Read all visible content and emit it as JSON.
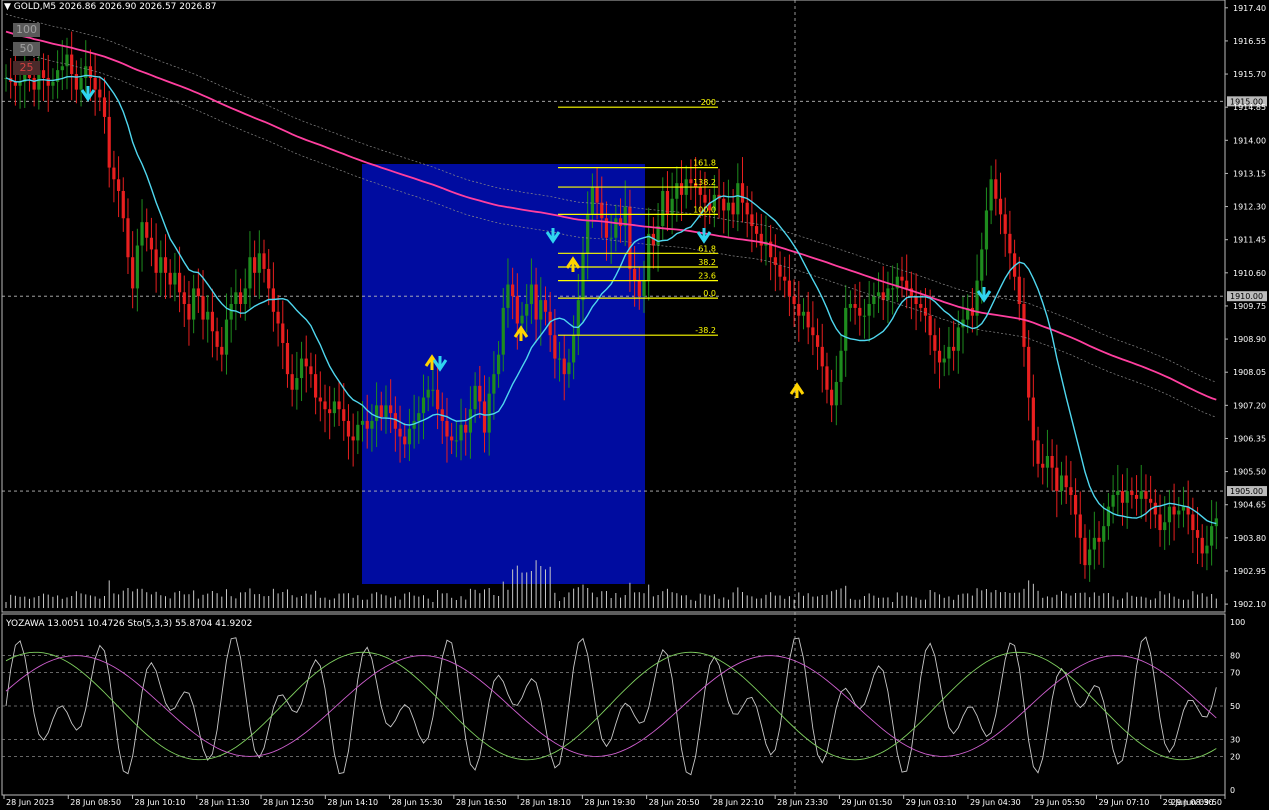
{
  "header": {
    "symbol_label": "GOLD,M5",
    "ohlc": "2026.86 2026.90 2026.57 2026.87",
    "indicator_label": "YOZAWA 13.0051 10.4726",
    "stoch_label": "Sto(5,3,3) 55.8704 41.9202"
  },
  "buttons": [
    {
      "label": "100",
      "color": "#a0a0a0"
    },
    {
      "label": "50",
      "color": "#a0a0a0"
    },
    {
      "label": "25",
      "color": "#d04040"
    }
  ],
  "colors": {
    "bull": "#1e8c1e",
    "bear": "#e81f1f",
    "ma_fast": "#4fd7ef",
    "ma_slow": "#ff3f9f",
    "session_box": "#000ca0",
    "fib": "#ffff00",
    "arrow_up": "#ffd400",
    "arrow_down": "#30d4ef",
    "stoch_main": "#c8c8c8",
    "stoch_green": "#7fcf5f",
    "stoch_pink": "#cf5fcf"
  },
  "price_axis": {
    "min": 1902.0,
    "max": 1917.6,
    "labels": [
      "1917.40",
      "1916.55",
      "1915.70",
      "1914.85",
      "1914.00",
      "1913.15",
      "1912.30",
      "1911.45",
      "1910.60",
      "1909.75",
      "1908.90",
      "1908.05",
      "1907.20",
      "1906.35",
      "1905.50",
      "1904.65",
      "1903.80",
      "1902.95",
      "1902.10"
    ],
    "highlight_levels": [
      "1915.00",
      "1910.00",
      "1905.00"
    ]
  },
  "osc_axis": {
    "labels": [
      "100",
      "80",
      "70",
      "50",
      "30",
      "20",
      "0"
    ]
  },
  "time_axis": {
    "labels": [
      "28 Jun 2023",
      "28 Jun 08:50",
      "28 Jun 10:10",
      "28 Jun 11:30",
      "28 Jun 12:50",
      "28 Jun 14:10",
      "28 Jun 15:30",
      "28 Jun 16:50",
      "28 Jun 18:10",
      "28 Jun 19:30",
      "28 Jun 20:50",
      "28 Jun 22:10",
      "28 Jun 23:30",
      "29 Jun 01:50",
      "29 Jun 03:10",
      "29 Jun 04:30",
      "29 Jun 05:50",
      "29 Jun 07:10",
      "29 Jun 08:30",
      "29 Jun 09:50"
    ]
  },
  "fibonacci": {
    "levels": [
      "200",
      "161.8",
      "138.2",
      "100.0",
      "61.8",
      "38.2",
      "23.6",
      "0.0",
      "-38.2"
    ],
    "prices": [
      1914.85,
      1913.3,
      1912.8,
      1912.1,
      1911.1,
      1910.75,
      1910.4,
      1909.95,
      1909.0
    ]
  },
  "chart_data": {
    "type": "candlestick",
    "series": [
      {
        "name": "GOLD,M5",
        "values": [
          1915.6,
          1915.5,
          1915.4,
          1915.5,
          1915.7,
          1915.6,
          1915.3,
          1915.8,
          1915.6,
          1915.4,
          1915.5,
          1915.8,
          1915.9,
          1916.2,
          1915.7,
          1915.3,
          1915.6,
          1915.9,
          1915.6,
          1915.3,
          1915.1,
          1914.6,
          1913.3,
          1913.0,
          1912.7,
          1912.0,
          1911.0,
          1910.2,
          1911.3,
          1911.9,
          1911.5,
          1911.2,
          1910.6,
          1911.0,
          1910.6,
          1910.3,
          1910.6,
          1910.1,
          1909.8,
          1909.4,
          1910.2,
          1910.0,
          1909.4,
          1909.6,
          1909.1,
          1908.7,
          1908.5,
          1909.4,
          1909.8,
          1910.1,
          1909.8,
          1910.2,
          1911.0,
          1910.6,
          1911.1,
          1910.7,
          1910.2,
          1909.6,
          1909.3,
          1908.8,
          1908.0,
          1907.6,
          1907.9,
          1908.4,
          1908.2,
          1908.0,
          1907.4,
          1907.3,
          1907.1,
          1907.0,
          1907.3,
          1907.1,
          1906.8,
          1906.4,
          1906.3,
          1906.7,
          1906.8,
          1906.6,
          1906.8,
          1907.2,
          1906.9,
          1907.2,
          1907.0,
          1906.6,
          1906.4,
          1906.2,
          1906.6,
          1906.8,
          1907.0,
          1907.4,
          1907.6,
          1907.6,
          1907.1,
          1906.8,
          1906.4,
          1906.3,
          1906.3,
          1906.7,
          1906.5,
          1907.1,
          1907.7,
          1907.3,
          1906.5,
          1907.5,
          1908.0,
          1908.5,
          1909.7,
          1910.3,
          1910.0,
          1909.3,
          1909.5,
          1909.8,
          1910.3,
          1909.4,
          1909.9,
          1909.6,
          1909.0,
          1908.4,
          1908.4,
          1908.0,
          1908.3,
          1909.0,
          1909.9,
          1911.1,
          1912.1,
          1912.8,
          1912.4,
          1912.0,
          1911.5,
          1911.5,
          1912.0,
          1911.8,
          1912.3,
          1910.7,
          1910.4,
          1910.0,
          1910.4,
          1911.6,
          1911.3,
          1911.8,
          1912.7,
          1912.1,
          1912.5,
          1912.9,
          1912.6,
          1913.0,
          1912.9,
          1912.8,
          1912.6,
          1912.4,
          1912.2,
          1912.6,
          1912.5,
          1912.2,
          1912.4,
          1912.1,
          1912.9,
          1912.4,
          1912.1,
          1911.8,
          1911.6,
          1911.3,
          1911.4,
          1911.0,
          1910.8,
          1910.5,
          1910.4,
          1910.0,
          1909.8,
          1909.5,
          1909.6,
          1909.2,
          1909.0,
          1908.7,
          1908.2,
          1907.6,
          1907.2,
          1907.8,
          1908.6,
          1909.7,
          1909.8,
          1909.7,
          1909.5,
          1909.5,
          1909.8,
          1910.0,
          1910.1,
          1909.9,
          1910.2,
          1910.2,
          1910.5,
          1910.4,
          1910.2,
          1910.0,
          1909.8,
          1909.7,
          1909.5,
          1909.0,
          1908.6,
          1908.3,
          1908.4,
          1908.7,
          1908.6,
          1909.2,
          1909.4,
          1909.7,
          1909.5,
          1910.4,
          1911.2,
          1912.2,
          1913.0,
          1912.5,
          1912.1,
          1911.6,
          1911.1,
          1910.5,
          1909.8,
          1908.7,
          1907.4,
          1906.3,
          1905.7,
          1905.6,
          1905.9,
          1905.6,
          1905.0,
          1905.4,
          1905.1,
          1904.9,
          1904.4,
          1903.8,
          1903.1,
          1903.5,
          1903.8,
          1903.7,
          1904.1,
          1904.6,
          1904.9,
          1905.0,
          1904.7,
          1905.0,
          1904.9,
          1904.8,
          1905.0,
          1904.8,
          1904.7,
          1904.4,
          1904.0,
          1904.2,
          1904.6,
          1904.4,
          1904.5,
          1904.6,
          1904.4,
          1904.0,
          1903.8,
          1903.4,
          1903.6,
          1904.1,
          1904.3
        ]
      }
    ]
  }
}
